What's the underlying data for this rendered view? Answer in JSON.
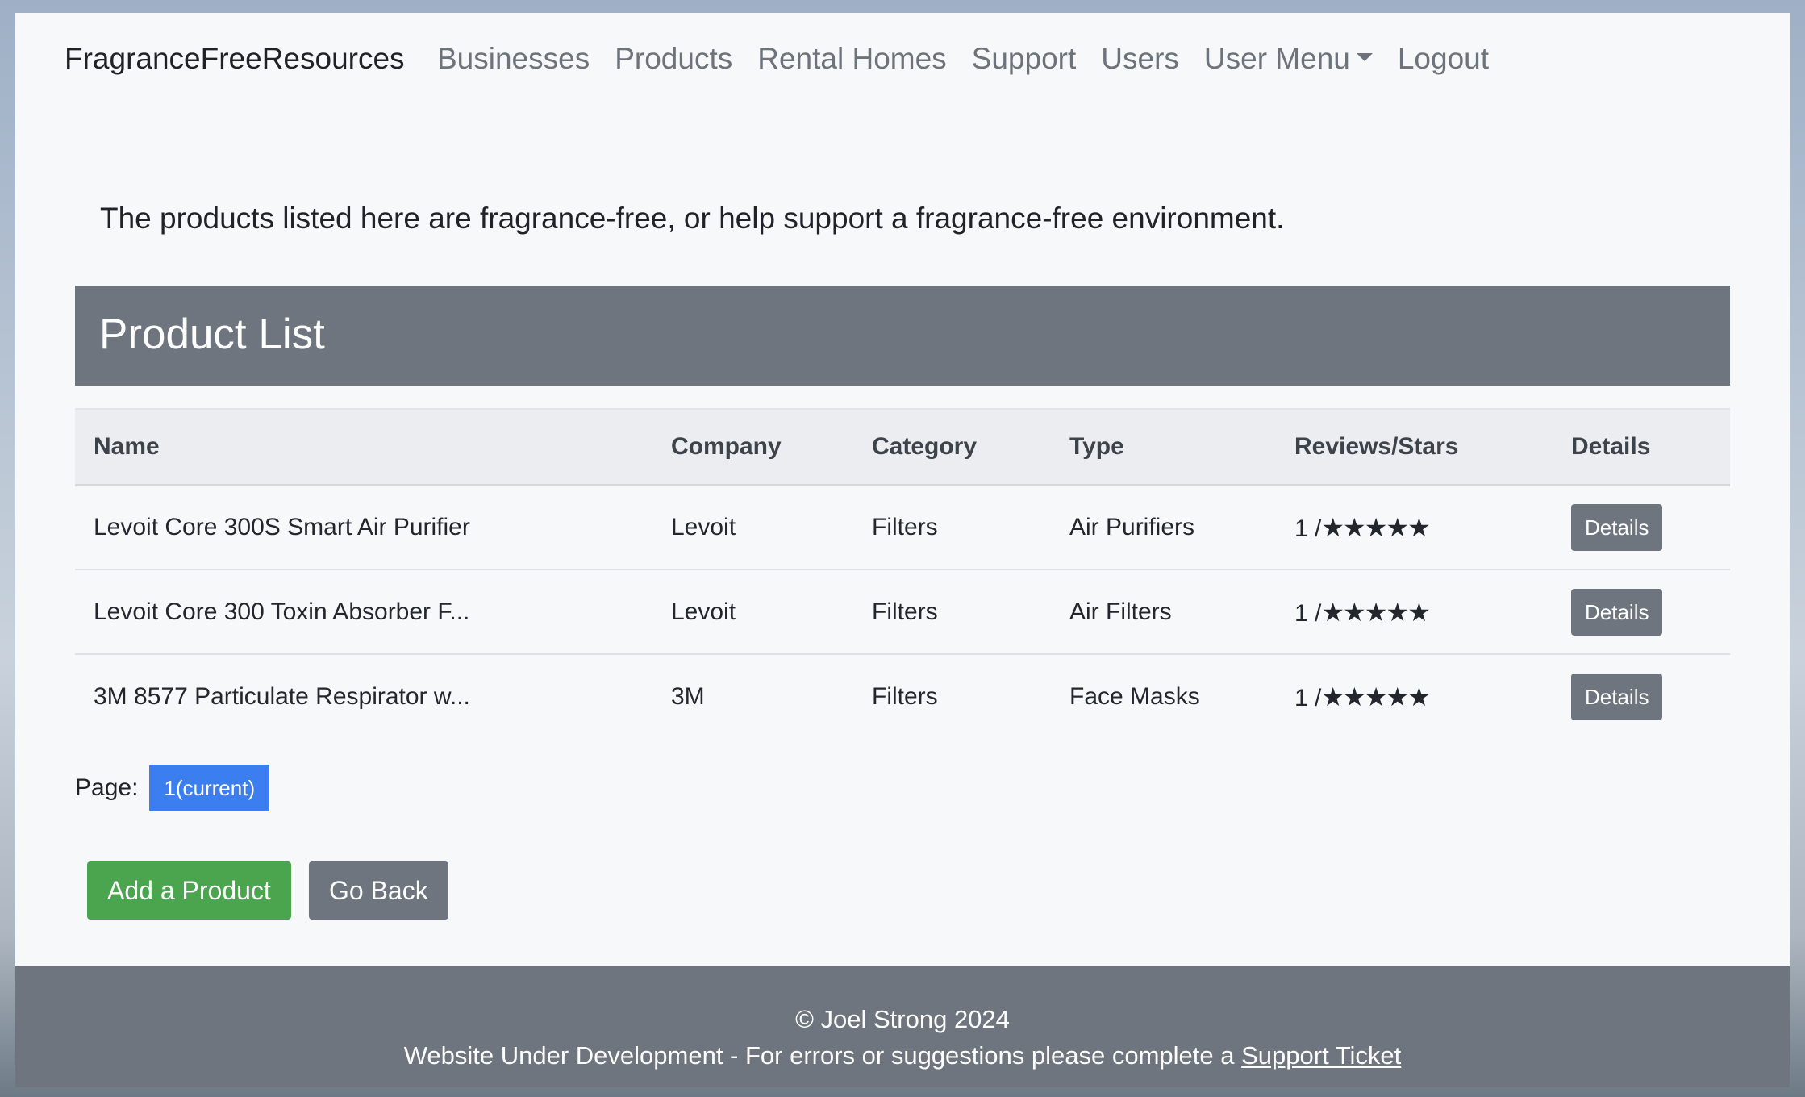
{
  "navbar": {
    "brand": "FragranceFreeResources",
    "links": [
      "Businesses",
      "Products",
      "Rental Homes",
      "Support",
      "Users",
      "User Menu",
      "Logout"
    ]
  },
  "intro_text": "The products listed here are fragrance-free, or help support a fragrance-free environment.",
  "card": {
    "title": "Product List"
  },
  "table": {
    "headers": [
      "Name",
      "Company",
      "Category",
      "Type",
      "Reviews/Stars",
      "Details"
    ],
    "rows": [
      {
        "name": "Levoit Core 300S Smart Air Purifier",
        "company": "Levoit",
        "category": "Filters",
        "type": "Air Purifiers",
        "reviews": "1 /",
        "stars": 5,
        "details_label": "Details"
      },
      {
        "name": "Levoit Core 300 Toxin Absorber F...",
        "company": "Levoit",
        "category": "Filters",
        "type": "Air Filters",
        "reviews": "1 /",
        "stars": 5,
        "details_label": "Details"
      },
      {
        "name": "3M 8577 Particulate Respirator w...",
        "company": "3M",
        "category": "Filters",
        "type": "Face Masks",
        "reviews": "1 /",
        "stars": 5,
        "details_label": "Details"
      }
    ]
  },
  "pager": {
    "label": "Page:",
    "current": "1(current)"
  },
  "actions": {
    "add_label": "Add a Product",
    "back_label": "Go Back"
  },
  "footer": {
    "copyright": "© Joel Strong 2024",
    "message": "Website Under Development - For errors or suggestions please complete a",
    "link": "Support Ticket"
  },
  "colors": {
    "header_bg": "#6f757e",
    "page_btn": "#3b7ef0",
    "add_btn": "#4aa54e"
  }
}
